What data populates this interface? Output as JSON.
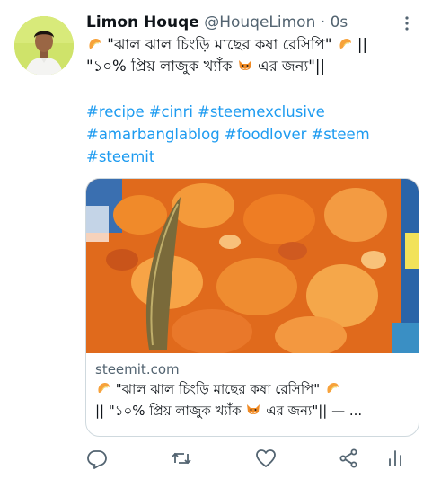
{
  "author": {
    "display_name": "Limon Houqe",
    "handle": "@HouqeLimon",
    "separator": "·",
    "time": "0s"
  },
  "tweet": {
    "line1": "\"ঝাল ঝাল চিংড়ি মাছের কষা রেসিপি\"",
    "line1_suffix": "||",
    "line2": "\"১০% প্রিয় লাজুক খ্যাঁক",
    "line2_suffix": "এর জন্য\"||",
    "hashtags": [
      [
        "#recipe",
        "#cinri",
        "#steemexclusive"
      ],
      [
        "#amarbanglablog",
        "#foodlover",
        "#steem"
      ],
      [
        "#steemit"
      ]
    ]
  },
  "card": {
    "domain": "steemit.com",
    "desc_line1": "\"ঝাল ঝাল চিংড়ি মাছের কষা রেসিপি\"",
    "desc_line2_a": "|| \"১০% প্রিয় লাজুক খ্যাঁক",
    "desc_line2_b": "এর জন্য\"|| — ..."
  },
  "icons": {
    "more": "more-vertical-icon",
    "shrimp": "shrimp-emoji-icon",
    "fox": "fox-emoji-icon",
    "reply": "reply-icon",
    "retweet": "retweet-icon",
    "like": "heart-icon",
    "share": "share-icon",
    "analytics": "analytics-icon"
  },
  "colors": {
    "link": "#1d9bf0",
    "muted": "#536471",
    "text": "#0f1419",
    "border": "#cfd9de"
  }
}
